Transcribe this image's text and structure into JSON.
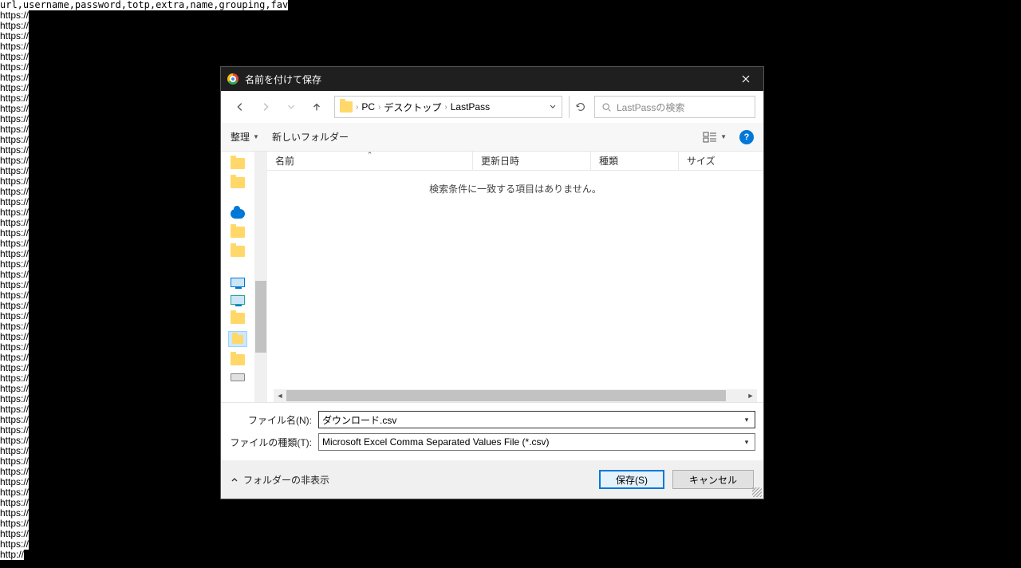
{
  "background": {
    "header": "url,username,password,totp,extra,name,grouping,fav",
    "line_https": "https://",
    "line_http": "http://",
    "line_count": 53
  },
  "dialog": {
    "title": "名前を付けて保存",
    "breadcrumb": {
      "pc": "PC",
      "desktop": "デスクトップ",
      "folder": "LastPass"
    },
    "search_placeholder": "LastPassの検索",
    "toolbar": {
      "organize": "整理",
      "new_folder": "新しいフォルダー"
    },
    "columns": {
      "name": "名前",
      "date": "更新日時",
      "type": "種類",
      "size": "サイズ"
    },
    "empty_msg": "検索条件に一致する項目はありません。",
    "filename_label": "ファイル名(N):",
    "filename_value": "ダウンロード.csv",
    "filetype_label": "ファイルの種類(T):",
    "filetype_value": "Microsoft Excel Comma Separated Values File (*.csv)",
    "hide_folders": "フォルダーの非表示",
    "save": "保存(S)",
    "cancel": "キャンセル",
    "help": "?"
  }
}
